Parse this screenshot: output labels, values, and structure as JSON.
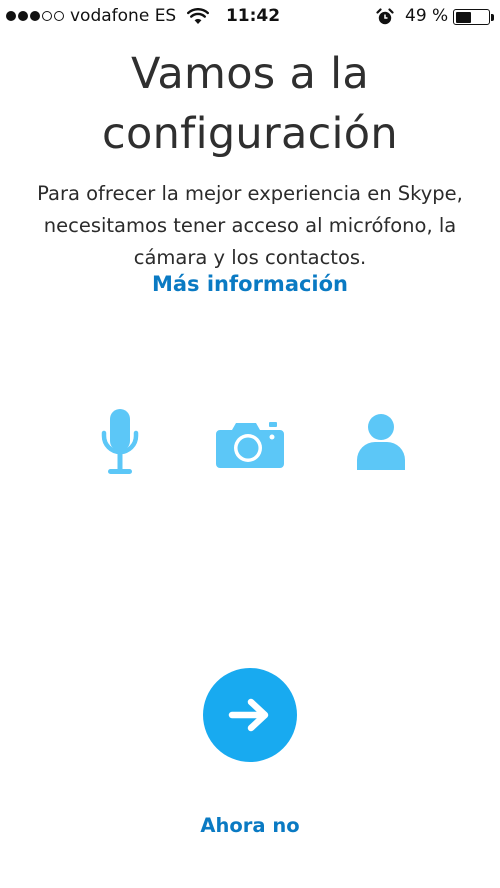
{
  "status_bar": {
    "signal_strength": {
      "filled": 3,
      "total": 5
    },
    "carrier": "vodafone ES",
    "wifi_icon": "wifi-icon",
    "time": "11:42",
    "alarm_icon": "alarm-clock-icon",
    "battery_percent": "49 %",
    "battery_level": 0.49
  },
  "onboarding": {
    "title_line1": "Vamos a la",
    "title_line2": "configuración",
    "description_line1": "Para ofrecer la mejor experiencia en Skype,",
    "description_line2": "necesitamos tener acceso al micrófono, la",
    "description_line3": "cámara y los contactos.",
    "more_info_link": "Más información",
    "permission_icons": [
      "microphone-icon",
      "camera-icon",
      "contact-person-icon"
    ],
    "next_button_icon": "arrow-right-icon",
    "skip_link": "Ahora no"
  },
  "colors": {
    "accent_blue": "#18aaf0",
    "icon_blue": "#5cc7f7",
    "link_blue": "#0a7ac3",
    "text_dark": "#2f2f2f"
  }
}
